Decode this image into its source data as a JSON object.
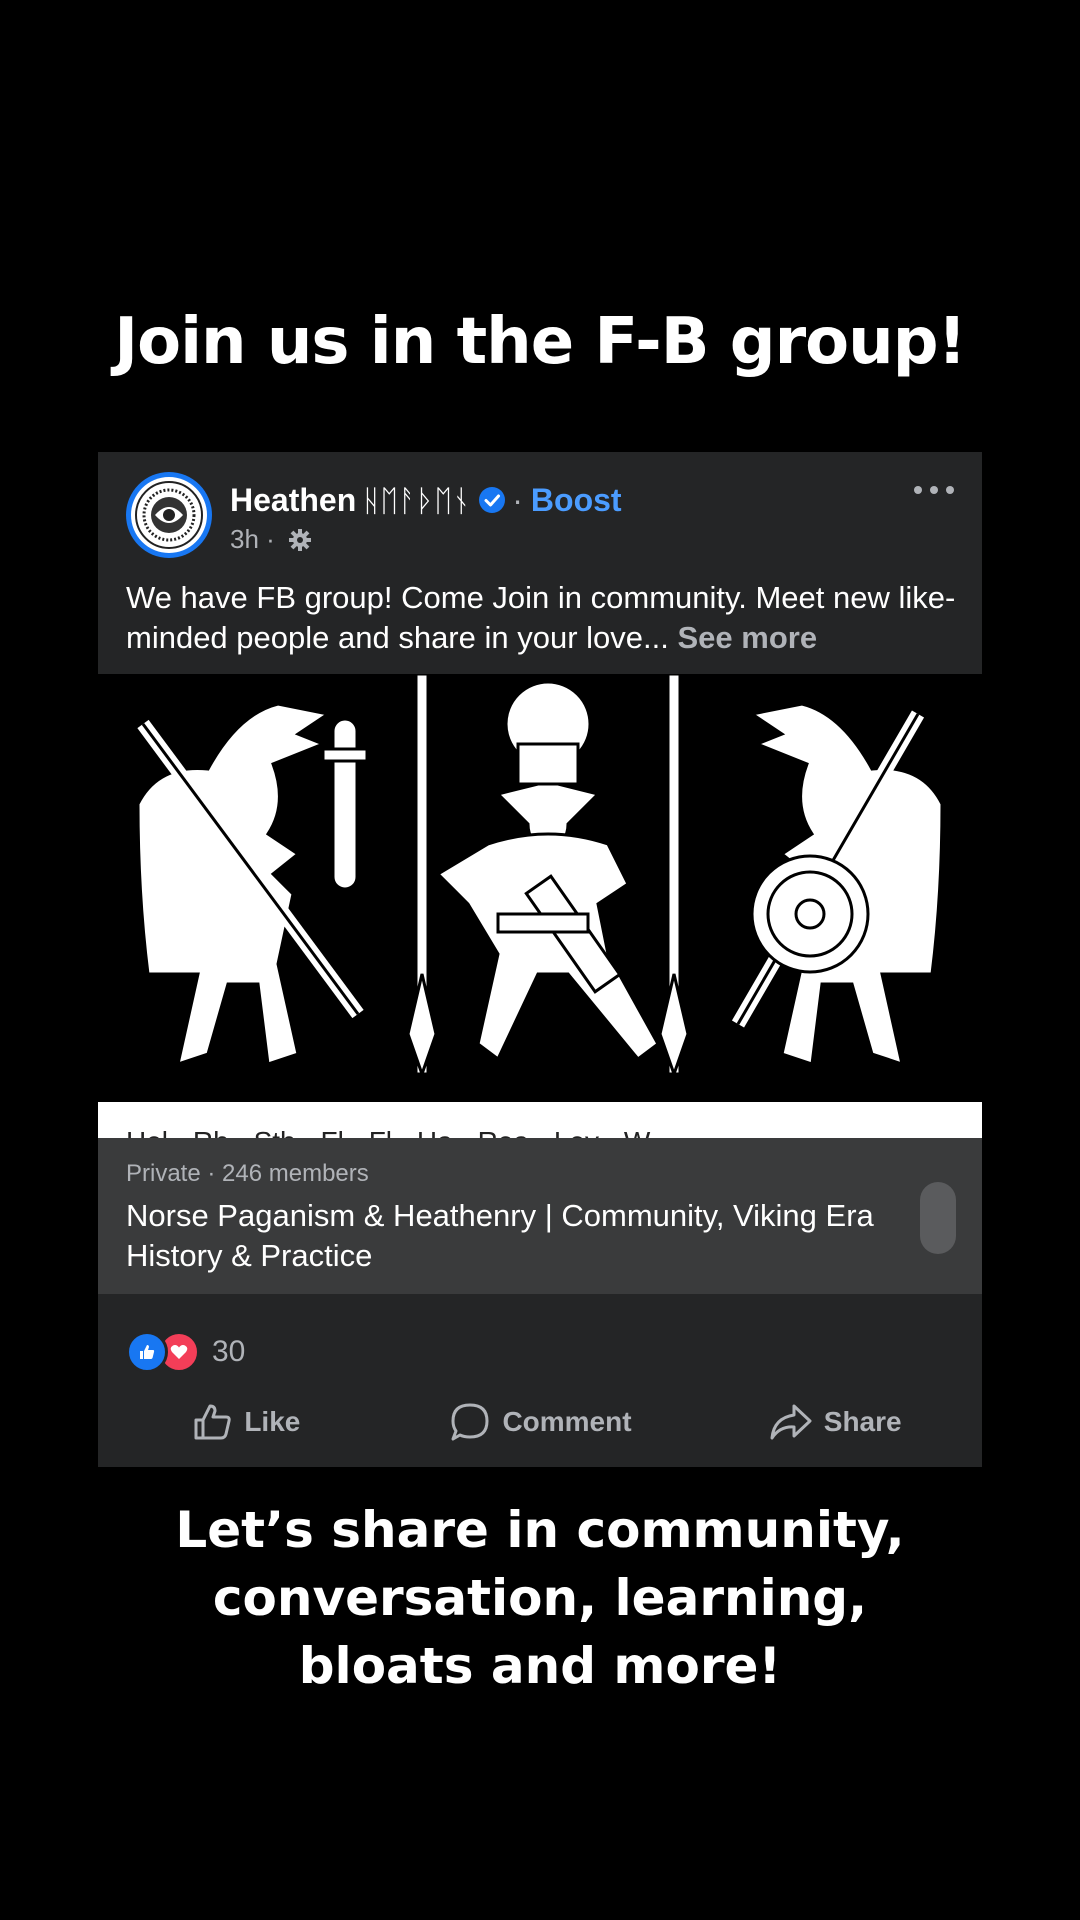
{
  "overlay": {
    "headline": "Join us in the F-B group!",
    "footer_line1": "Let’s share in community,",
    "footer_line2": "conversation, learning,",
    "footer_line3": "bloats and more!"
  },
  "post": {
    "page_name": "Heathen",
    "page_name_runes": "ᚺᛖᚨᚦᛖᚾ",
    "dot_separator": "·",
    "boost_label": "Boost",
    "time_ago": "3h ·",
    "text": "We have FB group! Come Join in community. Meet new like-minded people and share in your love...",
    "see_more": "See more",
    "image_strip_text": "Hel · Rh · Sth · Fl · Fl · Ha · Rea · Lev · W",
    "group": {
      "meta": "Private · 246 members",
      "name": "Norse Paganism & Heathenry | Community, Viking Era History & Practice"
    },
    "reactions_count": "30",
    "actions": {
      "like": "Like",
      "comment": "Comment",
      "share": "Share"
    }
  },
  "colors": {
    "background": "#000000",
    "card": "#242526",
    "group_box": "#3a3b3c",
    "accent": "#4b9cff",
    "secondary_text": "#b0b3b8",
    "love": "#f33e58"
  },
  "icons": [
    "verified-icon",
    "settings-icon",
    "more-icon",
    "like-reaction-icon",
    "love-reaction-icon",
    "like-icon",
    "comment-icon",
    "share-icon"
  ]
}
